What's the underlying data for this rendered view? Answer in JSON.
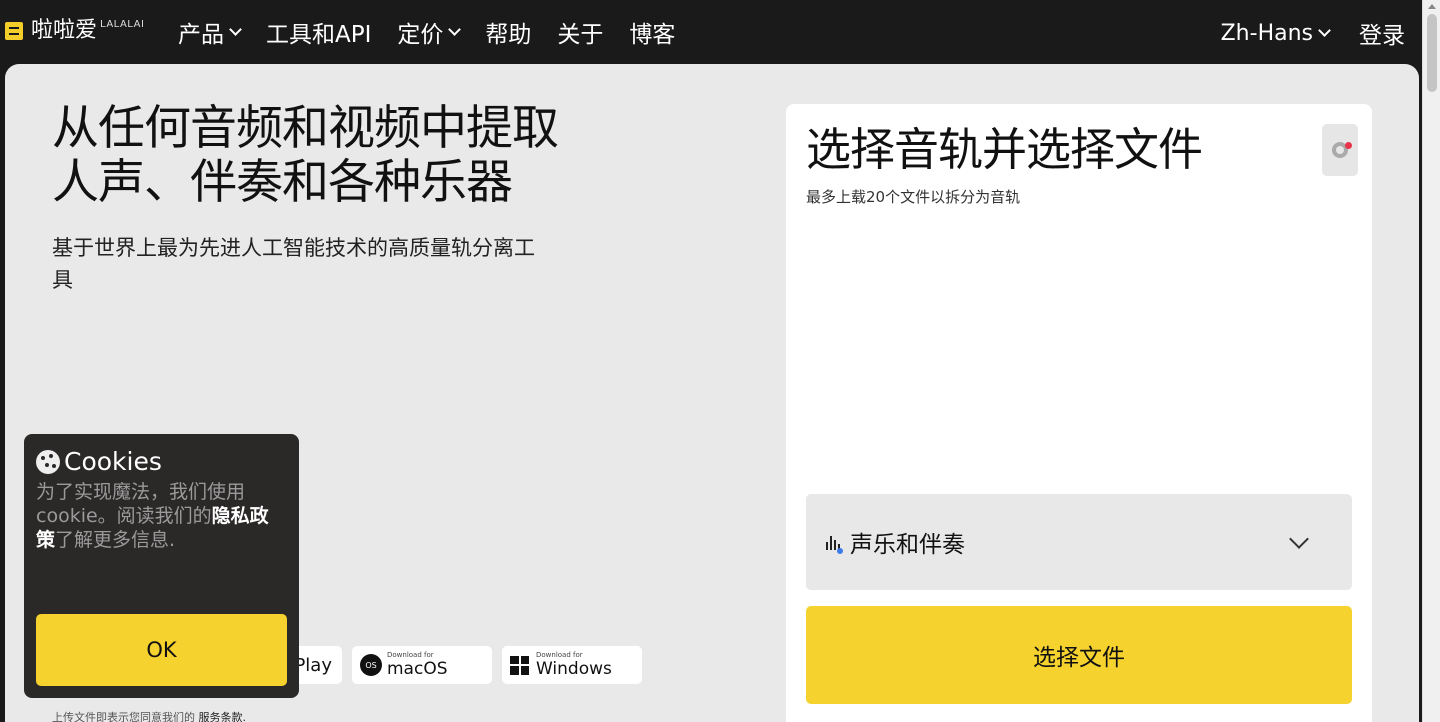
{
  "nav": {
    "logo_text": "啦啦爱",
    "logo_sup": "LALALAI",
    "items": [
      {
        "label": "产品",
        "has_dropdown": true
      },
      {
        "label": "工具和API",
        "has_dropdown": false
      },
      {
        "label": "定价",
        "has_dropdown": true
      },
      {
        "label": "帮助",
        "has_dropdown": false
      },
      {
        "label": "关于",
        "has_dropdown": false
      },
      {
        "label": "博客",
        "has_dropdown": false
      }
    ],
    "language": "Zh-Hans",
    "login": "登录"
  },
  "hero": {
    "title_line1": "从任何音频和视频中提取",
    "title_line2": "人声、伴奏和各种乐器",
    "subtitle": "基于世界上最为先进人工智能技术的高质量轨分离工具"
  },
  "downloads": {
    "google_play_partial": "Play",
    "mac_small": "Download for",
    "mac_big": "macOS",
    "mac_icon_text": "OS",
    "win_small": "Download for",
    "win_big": "Windows"
  },
  "terms": {
    "prefix": "上传文件即表示您同意我们的",
    "link": "服务条款."
  },
  "upload_card": {
    "title": "选择音轨并选择文件",
    "subtitle": "最多上载20个文件以拆分为音轨",
    "track_label": "声乐和伴奏",
    "choose_button": "选择文件"
  },
  "cookie": {
    "title": "Cookies",
    "body_prefix": "为了实现魔法，我们使用cookie。阅读我们的",
    "body_link": "隐私政策",
    "body_suffix": "了解更多信息.",
    "ok": "OK"
  },
  "colors": {
    "accent_yellow": "#f6d22e",
    "nav_bg": "#1a1a1a",
    "panel_bg": "#e9e9e9",
    "notification_red": "#e8334a"
  }
}
